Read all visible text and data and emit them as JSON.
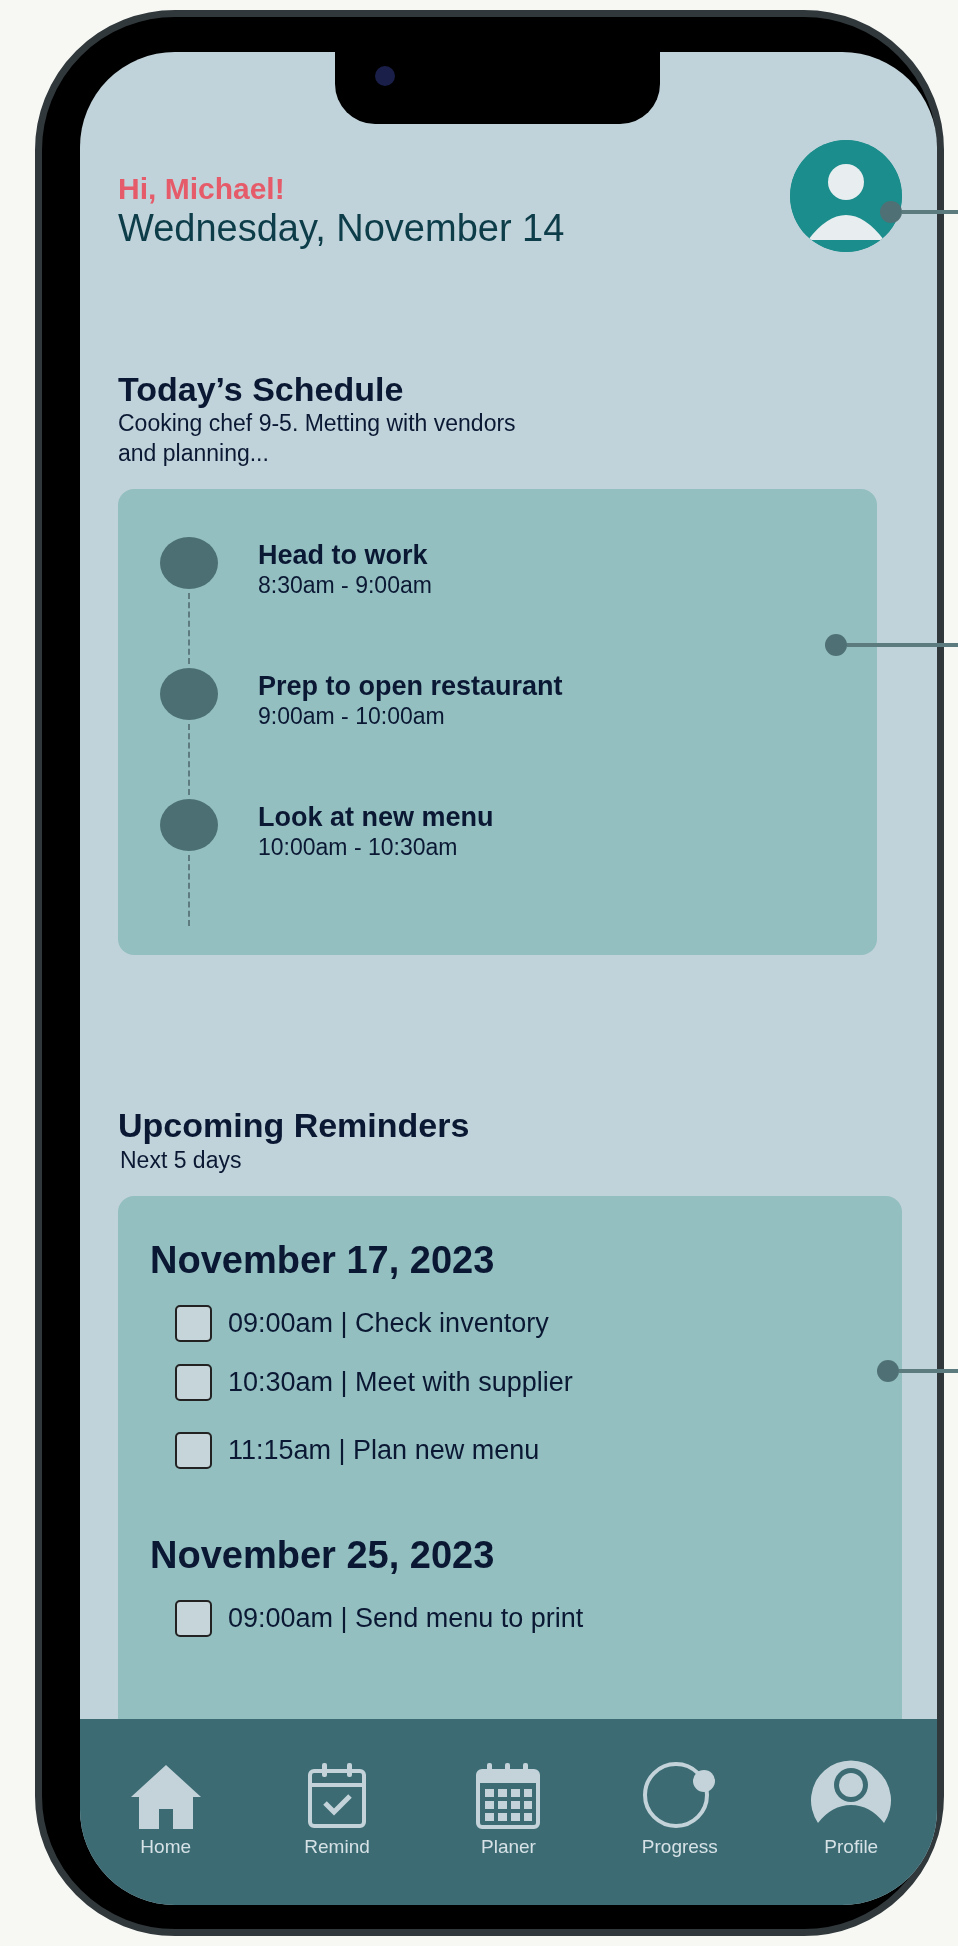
{
  "header": {
    "greeting": "Hi, Michael!",
    "date": "Wednesday, November 14"
  },
  "schedule": {
    "title": "Today’s Schedule",
    "description": "Cooking chef 9-5. Metting with vendors and planning...",
    "items": [
      {
        "title": "Head to work",
        "time": "8:30am - 9:00am"
      },
      {
        "title": "Prep to open restaurant",
        "time": "9:00am - 10:00am"
      },
      {
        "title": "Look at new menu",
        "time": "10:00am - 10:30am"
      }
    ]
  },
  "reminders": {
    "title": "Upcoming Reminders",
    "subtitle": "Next 5 days",
    "days": [
      {
        "date": "November 17, 2023",
        "items": [
          {
            "text": "09:00am | Check inventory",
            "checked": false
          },
          {
            "text": "10:30am | Meet with supplier",
            "checked": false
          },
          {
            "text": "11:15am | Plan new menu",
            "checked": false
          }
        ]
      },
      {
        "date": "November 25, 2023",
        "items": [
          {
            "text": "09:00am | Send menu to print",
            "checked": false
          }
        ]
      }
    ]
  },
  "nav": [
    {
      "label": "Home"
    },
    {
      "label": "Remind"
    },
    {
      "label": "Planer"
    },
    {
      "label": "Progress"
    },
    {
      "label": "Profile"
    }
  ]
}
